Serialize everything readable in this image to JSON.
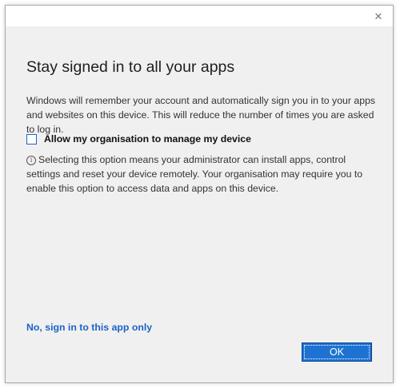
{
  "titlebar": {
    "close_glyph": "✕"
  },
  "dialog": {
    "title": "Stay signed in to all your apps",
    "description": "Windows will remember your account and automatically sign you in to your apps and websites on this device. This will reduce the number of times you are asked to log in.",
    "checkbox": {
      "label": "Allow my organisation to manage my device",
      "checked": false
    },
    "info": {
      "icon_glyph": "i",
      "text": "Selecting this option means your administrator can install apps, control settings and reset your device remotely. Your organisation may require you to enable this option to access data and apps on this device."
    },
    "link_label": "No, sign in to this app only",
    "ok_label": "OK"
  },
  "colors": {
    "accent": "#1e73d2",
    "link": "#1b63c6",
    "background": "#f0f0f0"
  }
}
